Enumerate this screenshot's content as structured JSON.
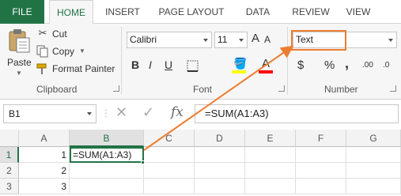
{
  "tabs": [
    "FILE",
    "HOME",
    "INSERT",
    "PAGE LAYOUT",
    "DATA",
    "REVIEW",
    "VIEW"
  ],
  "clipboard": {
    "paste": "Paste",
    "cut": "Cut",
    "copy": "Copy",
    "format_painter": "Format Painter",
    "group_label": "Clipboard"
  },
  "font": {
    "name": "Calibri",
    "size": "11",
    "increase": "A",
    "decrease": "A",
    "bold": "B",
    "italic": "I",
    "underline": "U",
    "font_color": "A",
    "group_label": "Font"
  },
  "number": {
    "format": "Text",
    "currency": "$",
    "percent": "%",
    "comma": ",",
    "inc_decimal": ".00",
    "dec_decimal": ".0",
    "group_label": "Number"
  },
  "formula_bar": {
    "name_box": "B1",
    "cancel": "✕",
    "enter": "✓",
    "fx": "fx",
    "formula": "=SUM(A1:A3)"
  },
  "grid": {
    "columns": [
      "A",
      "B",
      "C",
      "D",
      "E",
      "F",
      "G"
    ],
    "rows": [
      "1",
      "2",
      "3"
    ],
    "cells": {
      "A1": "1",
      "A2": "2",
      "A3": "3",
      "B1": "=SUM(A1:A3)"
    }
  },
  "colors": {
    "excel_green": "#217346",
    "callout_orange": "#ed7d31",
    "highlight_yellow": "#ffff00",
    "font_red": "#ff0000"
  }
}
